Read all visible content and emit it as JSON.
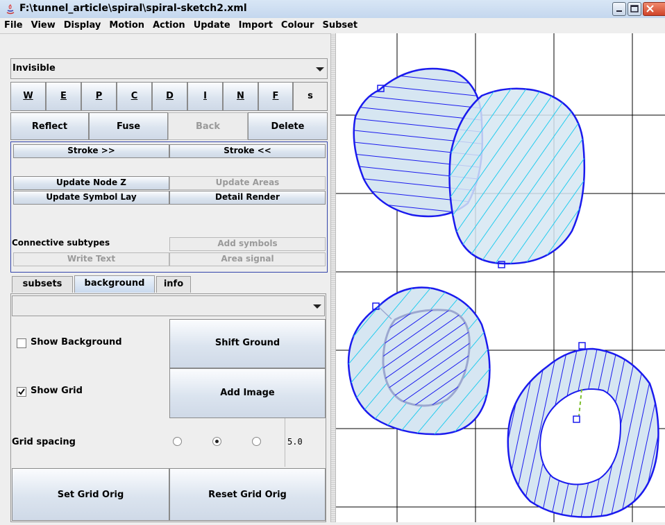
{
  "window": {
    "title": "F:\\tunnel_article\\spiral\\spiral-sketch2.xml"
  },
  "menu": [
    "File",
    "View",
    "Display",
    "Motion",
    "Action",
    "Update",
    "Import",
    "Colour",
    "Subset"
  ],
  "mode_select": {
    "value": "Invisible"
  },
  "letter_buttons": [
    "W",
    "E",
    "P",
    "C",
    "D",
    "I",
    "N",
    "F",
    "s"
  ],
  "edit_buttons": {
    "reflect": "Reflect",
    "fuse": "Fuse",
    "back": "Back",
    "delete": "Delete"
  },
  "stroke": {
    "forward": "Stroke >>",
    "backward": "Stroke <<"
  },
  "update": {
    "node_z": "Update Node Z",
    "areas": "Update Areas",
    "symbol_lay": "Update Symbol Lay",
    "detail_render": "Detail Render"
  },
  "connective": {
    "label": "Connective subtypes",
    "add_symbols": "Add symbols",
    "write_text": "Write Text",
    "area_signal": "Area signal"
  },
  "tabs": [
    {
      "label": "subsets"
    },
    {
      "label": "background",
      "active": true
    },
    {
      "label": "info"
    }
  ],
  "background_panel": {
    "image_select": "",
    "show_background": {
      "label": "Show Background",
      "checked": false
    },
    "show_grid": {
      "label": "Show Grid",
      "checked": true
    },
    "shift_ground": "Shift Ground",
    "add_image": "Add Image",
    "grid_spacing": {
      "label": "Grid spacing",
      "selected_index": 1,
      "value": "5.0"
    },
    "set_grid_orig": "Set Grid Orig",
    "reset_grid_orig": "Reset Grid Orig"
  },
  "colors": {
    "stroke_blue": "#1a1aee",
    "hatch_cyan": "#22ccee",
    "fill_light": "#d6e6f2",
    "grid": "#000000"
  }
}
